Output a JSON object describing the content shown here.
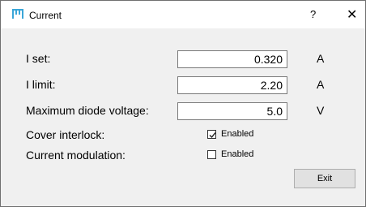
{
  "window": {
    "title": "Current",
    "help_label": "?",
    "close_label": "✕",
    "accent_color": "#3aa6d8"
  },
  "form": {
    "i_set": {
      "label": "I set:",
      "value": "0.320",
      "unit": "A"
    },
    "i_limit": {
      "label": "I limit:",
      "value": "2.20",
      "unit": "A"
    },
    "max_diode_voltage": {
      "label": "Maximum diode voltage:",
      "value": "5.0",
      "unit": "V"
    },
    "cover_interlock": {
      "label": "Cover interlock:",
      "checkbox_label": "Enabled",
      "checked": true
    },
    "current_modulation": {
      "label": "Current modulation:",
      "checkbox_label": "Enabled",
      "checked": false
    }
  },
  "buttons": {
    "exit_label": "Exit"
  }
}
